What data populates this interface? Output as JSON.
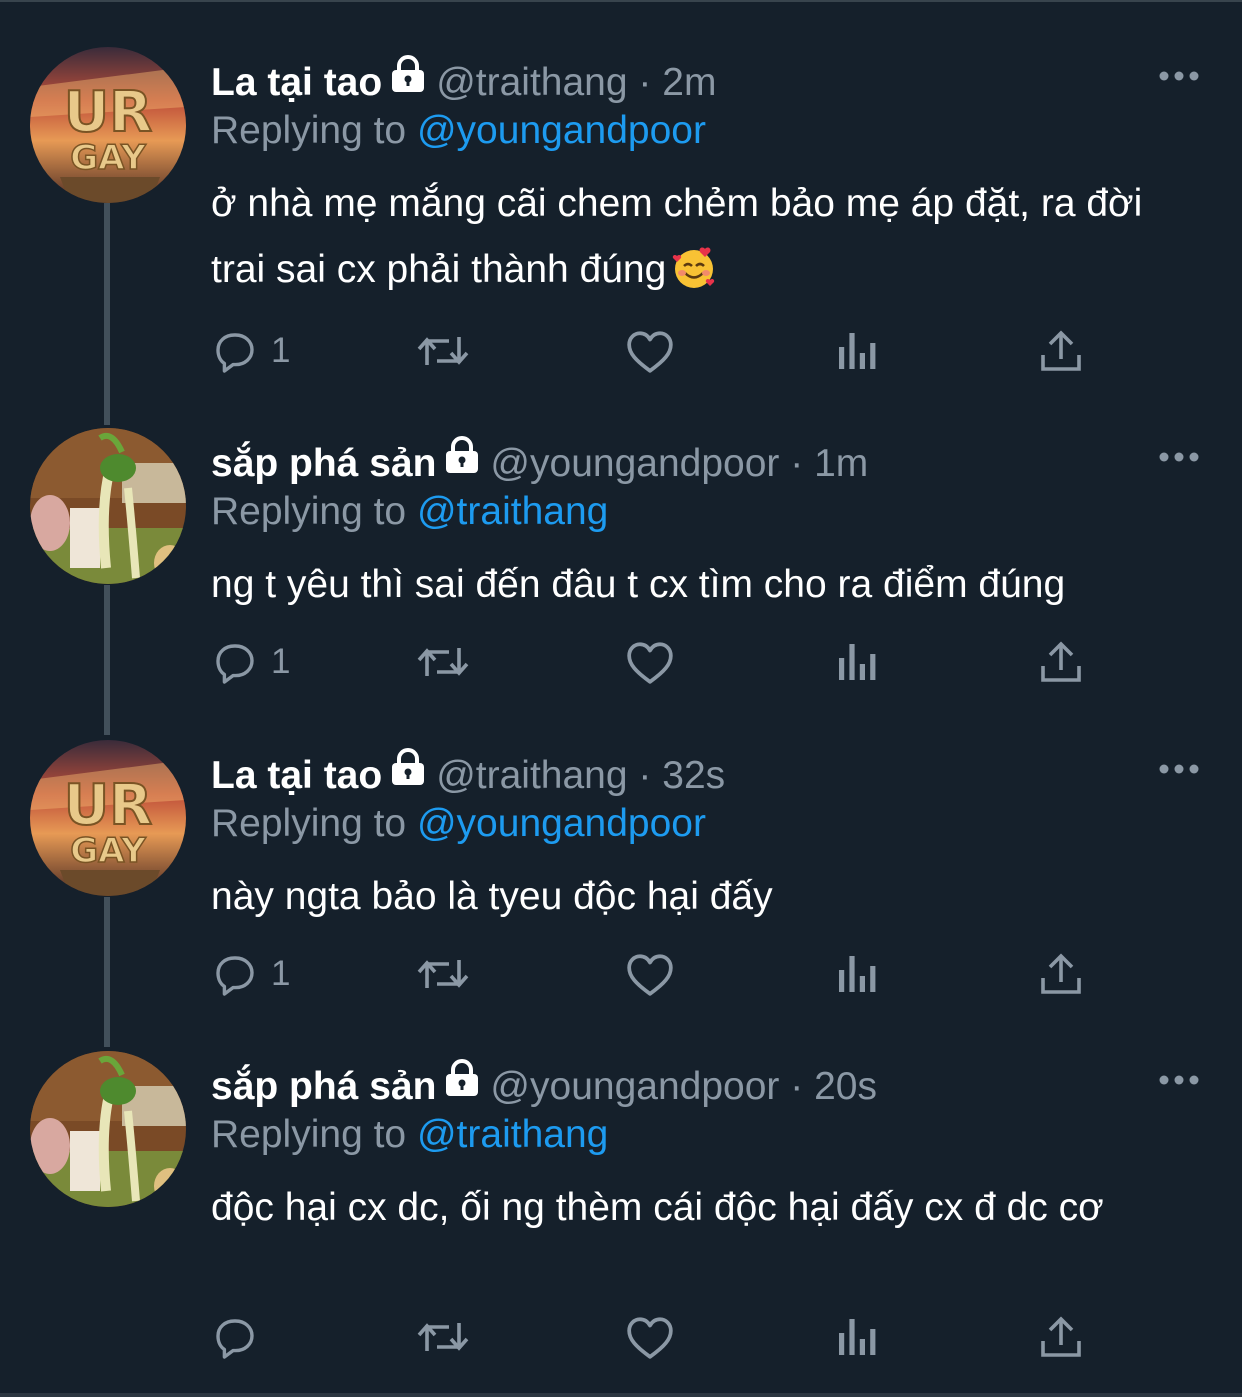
{
  "colors": {
    "background": "#15202b",
    "name": "#ffffff",
    "meta": "#8b98a5",
    "mention": "#1d9bf0",
    "thread_line": "#42505b"
  },
  "tweets": [
    {
      "avatar": "ur-gay-logo-avatar",
      "display_name": "La tại tao",
      "handle": "@traithang",
      "time": "2m",
      "reply_prefix": "Replying to",
      "reply_to": "@youngandpoor",
      "text": "ở nhà mẹ mắng cãi chem chẻm bảo mẹ áp đặt, ra đời trai sai cx phải thành đúng",
      "emoji": "smiling-face-with-hearts-emoji",
      "reply_count": "1"
    },
    {
      "avatar": "cartoon-frog-avatar",
      "display_name": "sắp phá sản",
      "handle": "@youngandpoor",
      "time": "1m",
      "reply_prefix": "Replying to",
      "reply_to": "@traithang",
      "text": "ng t yêu thì sai đến đâu t cx tìm cho ra điểm đúng",
      "reply_count": "1"
    },
    {
      "avatar": "ur-gay-logo-avatar",
      "display_name": "La tại tao",
      "handle": "@traithang",
      "time": "32s",
      "reply_prefix": "Replying to",
      "reply_to": "@youngandpoor",
      "text": "này ngta bảo là tyeu độc hại đấy",
      "reply_count": "1"
    },
    {
      "avatar": "cartoon-frog-avatar",
      "display_name": "sắp phá sản",
      "handle": "@youngandpoor",
      "time": "20s",
      "reply_prefix": "Replying to",
      "reply_to": "@traithang",
      "text": "độc hại cx dc, ối ng thèm cái độc hại đấy cx đ dc cơ",
      "reply_count": ""
    }
  ],
  "separator": "·",
  "icons": {
    "reply": "reply-icon",
    "retweet": "retweet-icon",
    "like": "like-icon",
    "views": "views-icon",
    "share": "share-icon",
    "more": "more-icon",
    "lock": "lock-icon"
  }
}
